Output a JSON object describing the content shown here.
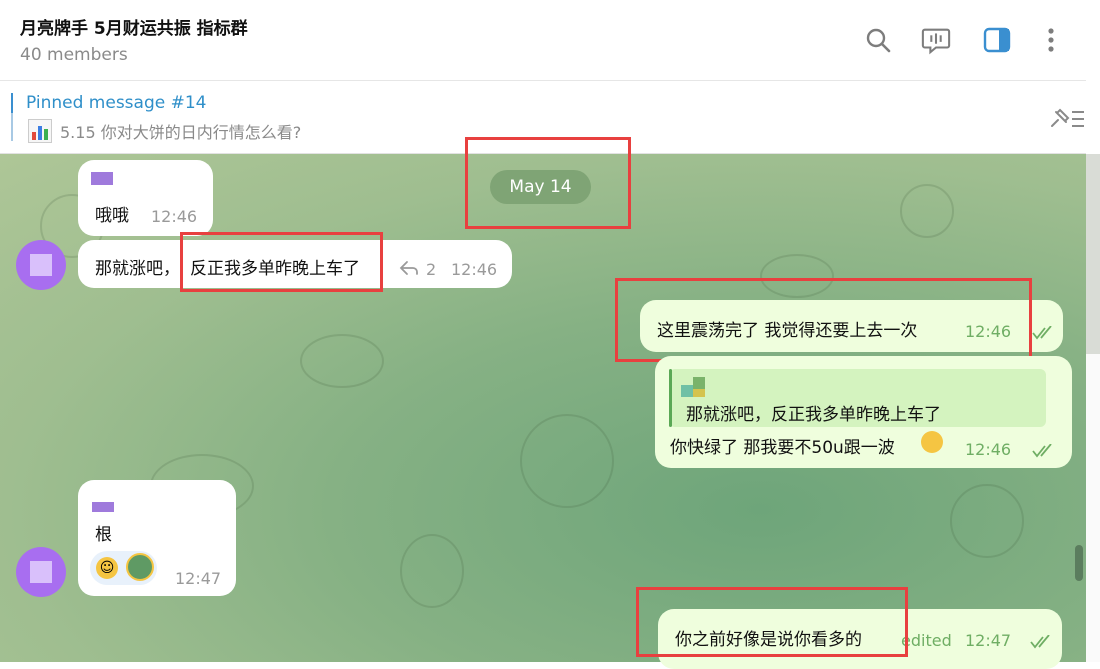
{
  "header": {
    "title": "月亮牌手 5月财运共振 指标群",
    "subtitle": "40 members",
    "icons": [
      "search-icon",
      "voice-chat-icon",
      "sidebar-toggle-icon",
      "more-icon"
    ],
    "accent": "#3a8fd0"
  },
  "pinned": {
    "title": "Pinned message #14",
    "text": "5.15 你对大饼的日内行情怎么看?"
  },
  "date_label": "May 14",
  "messages": [
    {
      "text": "哦哦",
      "time": "12:46"
    },
    {
      "text_a": "那就涨吧，",
      "text_b": "反正我多单昨晚上车了",
      "replies": "2",
      "time": "12:46"
    },
    {
      "text": "这里震荡完了 我觉得还要上去一次",
      "time": "12:46"
    },
    {
      "quote": "那就涨吧，反正我多单昨晚上车了",
      "text": "你快绿了 那我要不50u跟一波",
      "time": "12:46"
    },
    {
      "text": "根",
      "time": "12:47"
    },
    {
      "text": "你之前好像是说你看多的",
      "edited": "edited",
      "time": "12:47"
    }
  ],
  "colors": {
    "in_bubble": "#ffffff",
    "out_bubble": "#effedd",
    "highlight": "#e8403f",
    "date_pill": "#7fa475"
  }
}
